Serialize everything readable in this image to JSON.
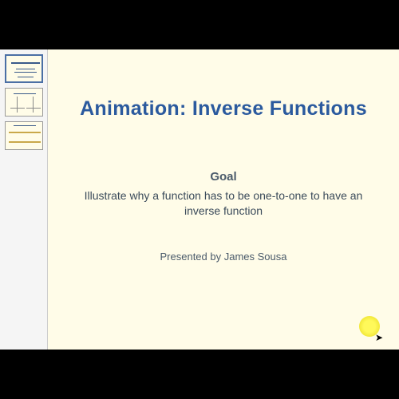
{
  "slide": {
    "title": "Animation:  Inverse Functions",
    "goal_heading": "Goal",
    "goal_text": "Illustrate why a function has to be one-to-one to have an inverse function",
    "presenter": "Presented by James Sousa"
  },
  "sidebar": {
    "thumbs": [
      {
        "label": "slide-1",
        "selected": true
      },
      {
        "label": "slide-2",
        "selected": false
      },
      {
        "label": "slide-3",
        "selected": false
      }
    ]
  }
}
